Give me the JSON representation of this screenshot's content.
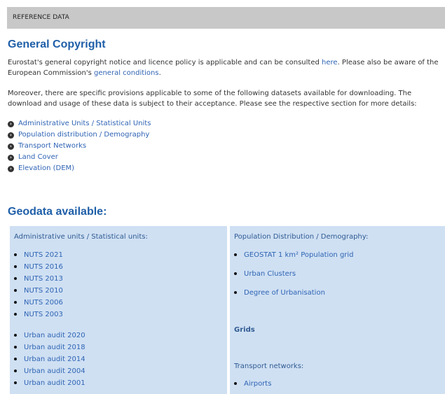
{
  "header": {
    "title": "REFERENCE DATA"
  },
  "general": {
    "heading": "General Copyright",
    "line1_a": "Eurostat's general copyright notice and licence policy is applicable and can be consulted ",
    "line1_link": "here",
    "line1_b": ". Please also be aware of the",
    "line2_a": "European Commission's ",
    "line2_link": "general conditions",
    "line2_b": ".",
    "para2_line1": "Moreover, there are specific provisions applicable to some of the following datasets available for downloading. The",
    "para2_line2": "download and usage of these data is subject to their acceptance.  Please see the respective section for more details:",
    "links": [
      "Administrative Units / Statistical Units",
      "Population distribution / Demography",
      "Transport Networks",
      "Land Cover",
      "Elevation (DEM)"
    ]
  },
  "geodata": {
    "heading": "Geodata available:",
    "left": {
      "title": "Administrative units / Statistical units:",
      "nuts": [
        "NUTS 2021",
        "NUTS 2016",
        "NUTS 2013",
        "NUTS 2010",
        "NUTS 2006",
        "NUTS 2003"
      ],
      "urban": [
        "Urban audit 2020",
        "Urban audit 2018",
        "Urban audit 2014",
        "Urban audit 2004",
        "Urban audit 2001"
      ]
    },
    "right": {
      "title": "Population Distribution / Demography:",
      "items": [
        "GEOSTAT 1 km² Population grid",
        "Urban Clusters",
        "Degree of Urbanisation"
      ],
      "grids_title": "Grids",
      "transport_title": "Transport networks:",
      "transport_items": [
        "Airports"
      ]
    }
  }
}
